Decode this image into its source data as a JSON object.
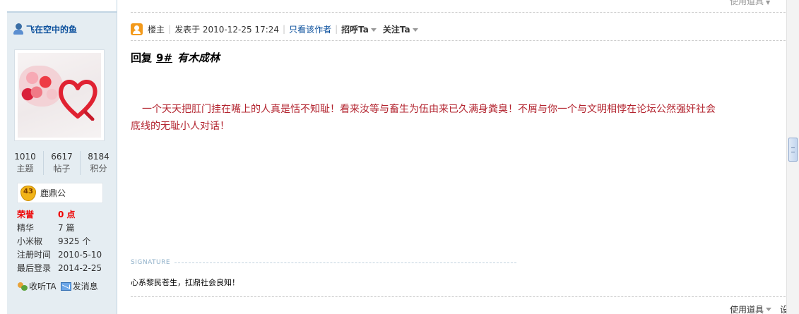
{
  "user": {
    "name": "飞在空中的鱼",
    "stats": [
      {
        "value": "1010",
        "label": "主题"
      },
      {
        "value": "6617",
        "label": "帖子"
      },
      {
        "value": "8184",
        "label": "积分"
      }
    ],
    "medal": {
      "level": "43",
      "name": "鹿鼎公"
    },
    "info": [
      {
        "key": "荣誉",
        "value": "0 点"
      },
      {
        "key": "精华",
        "value": "7 篇"
      },
      {
        "key": "小米椒",
        "value": "9325 个"
      },
      {
        "key": "注册时间",
        "value": "2010-5-10"
      },
      {
        "key": "最后登录",
        "value": "2014-2-25"
      }
    ],
    "actions": {
      "follow": "收听TA",
      "message": "发消息"
    }
  },
  "post": {
    "top_tools": "使用道具",
    "header": {
      "role": "楼主",
      "posted_at": "发表于 2010-12-25 17:24",
      "author_only": "只看该作者",
      "greet": "招呼Ta",
      "follow": "关注Ta"
    },
    "reply": {
      "prefix": "回复",
      "floor": "9#",
      "author": "有木成林"
    },
    "body_line1": "一个天天把肛门挂在嘴上的人真是恬不知耻！看来汝等与畜生为伍由来已久满身粪臭！不屑与你一个与文明相悖在论坛公然强奸社会",
    "body_line2": "底线的无耻小人对话！",
    "signature_label": "SIGNATURE",
    "signature": "心系黎民苍生，扛鼎社会良知！",
    "bottom_tools": "使用道具",
    "bottom_more": "设"
  },
  "colors": {
    "sidebar_bg": "#e5edf2",
    "body_text": "#b3242f",
    "link": "#0a4f9c",
    "honor": "#ee0000"
  }
}
